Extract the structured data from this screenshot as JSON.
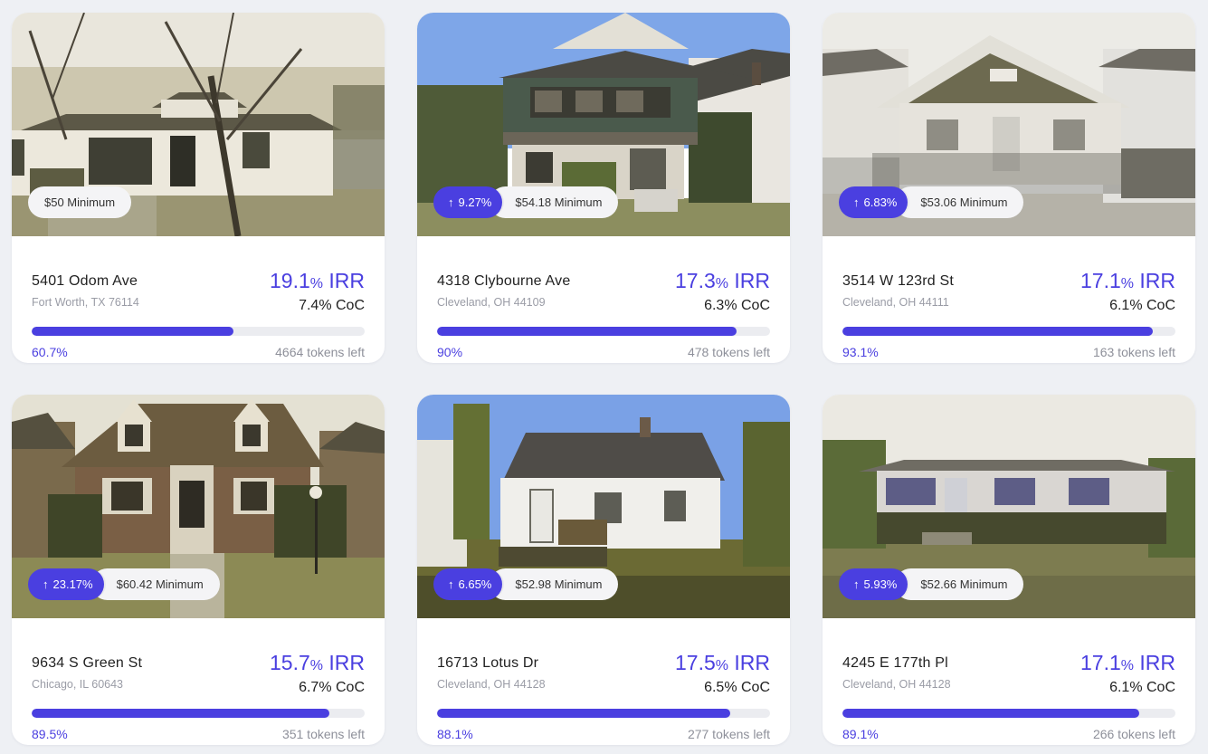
{
  "listings": [
    {
      "address": "5401 Odom Ave",
      "city": "Fort Worth, TX 76114",
      "irr_value": "19.1",
      "irr_pct": "%",
      "irr_label": " IRR",
      "coc": "7.4% CoC",
      "funded_label": "60.7%",
      "funded_fraction": 0.607,
      "tokens_left": "4664 tokens left",
      "appreciation": "",
      "minimum": "$50 Minimum",
      "photo_icon": "house-photo"
    },
    {
      "address": "4318 Clybourne Ave",
      "city": "Cleveland, OH 44109",
      "irr_value": "17.3",
      "irr_pct": "%",
      "irr_label": " IRR",
      "coc": "6.3% CoC",
      "funded_label": "90%",
      "funded_fraction": 0.9,
      "tokens_left": "478 tokens left",
      "appreciation": "9.27%",
      "minimum": "$54.18 Minimum",
      "photo_icon": "house-photo"
    },
    {
      "address": "3514 W 123rd St",
      "city": "Cleveland, OH 44111",
      "irr_value": "17.1",
      "irr_pct": "%",
      "irr_label": " IRR",
      "coc": "6.1% CoC",
      "funded_label": "93.1%",
      "funded_fraction": 0.931,
      "tokens_left": "163 tokens left",
      "appreciation": "6.83%",
      "minimum": "$53.06 Minimum",
      "photo_icon": "house-photo"
    },
    {
      "address": "9634 S Green St",
      "city": "Chicago, IL 60643",
      "irr_value": "15.7",
      "irr_pct": "%",
      "irr_label": " IRR",
      "coc": "6.7% CoC",
      "funded_label": "89.5%",
      "funded_fraction": 0.895,
      "tokens_left": "351 tokens left",
      "appreciation": "23.17%",
      "minimum": "$60.42 Minimum",
      "photo_icon": "house-photo"
    },
    {
      "address": "16713 Lotus Dr",
      "city": "Cleveland, OH 44128",
      "irr_value": "17.5",
      "irr_pct": "%",
      "irr_label": " IRR",
      "coc": "6.5% CoC",
      "funded_label": "88.1%",
      "funded_fraction": 0.881,
      "tokens_left": "277 tokens left",
      "appreciation": "6.65%",
      "minimum": "$52.98 Minimum",
      "photo_icon": "house-photo"
    },
    {
      "address": "4245 E 177th Pl",
      "city": "Cleveland, OH 44128",
      "irr_value": "17.1",
      "irr_pct": "%",
      "irr_label": " IRR",
      "coc": "6.1% CoC",
      "funded_label": "89.1%",
      "funded_fraction": 0.891,
      "tokens_left": "266 tokens left",
      "appreciation": "5.93%",
      "minimum": "$52.66 Minimum",
      "photo_icon": "house-photo"
    }
  ],
  "colors": {
    "accent": "#4a3fe0",
    "page_background": "#eef0f4",
    "card_background": "#ffffff",
    "progress_track": "#ebecf0"
  }
}
